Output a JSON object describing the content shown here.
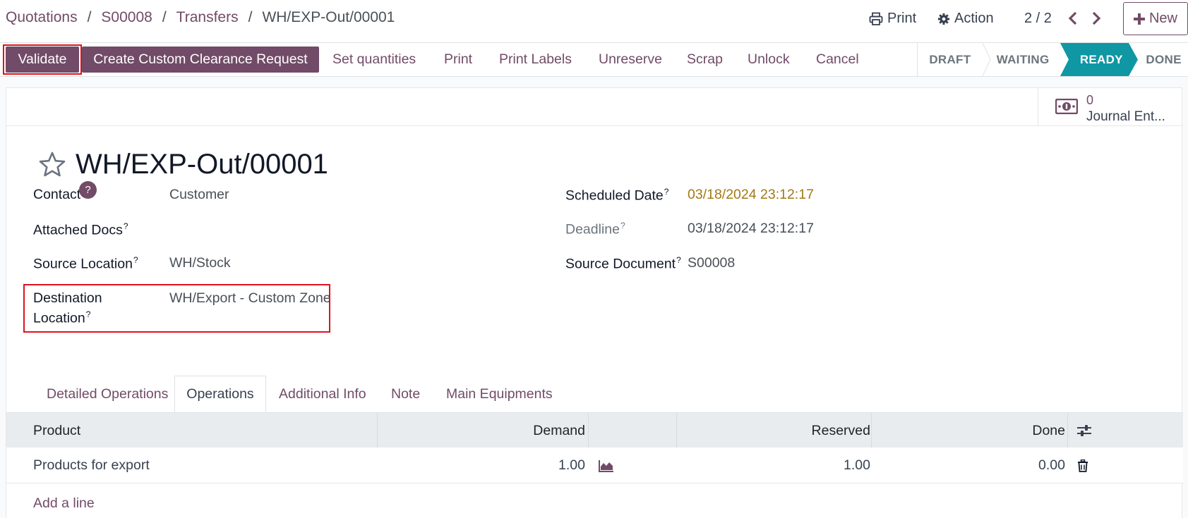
{
  "breadcrumb": {
    "items": [
      "Quotations",
      "S00008",
      "Transfers"
    ],
    "separator": "/",
    "current": "WH/EXP-Out/00001"
  },
  "top_actions": {
    "print_label": "Print",
    "action_label": "Action",
    "pager": "2 / 2",
    "new_label": "New"
  },
  "action_bar": {
    "validate": "Validate",
    "custom_clearance": "Create Custom Clearance Request",
    "set_quantities": "Set quantities",
    "print": "Print",
    "print_labels": "Print Labels",
    "unreserve": "Unreserve",
    "scrap": "Scrap",
    "unlock": "Unlock",
    "cancel": "Cancel"
  },
  "status": {
    "stages": [
      "DRAFT",
      "WAITING",
      "READY",
      "DONE"
    ],
    "active": "READY"
  },
  "smart_button": {
    "value": "0",
    "label": "Journal Ent..."
  },
  "record": {
    "title": "WH/EXP-Out/00001"
  },
  "fields": {
    "contact": {
      "label": "Contact",
      "badge": "?",
      "value": "Customer"
    },
    "attached_docs": {
      "label": "Attached Docs",
      "sup": "?",
      "value": ""
    },
    "source_location": {
      "label": "Source Location",
      "sup": "?",
      "value": "WH/Stock"
    },
    "destination_location": {
      "label_line1": "Destination",
      "label_line2": "Location",
      "sup": "?",
      "value": "WH/Export - Custom Zone"
    },
    "scheduled_date": {
      "label": "Scheduled Date",
      "sup": "?",
      "value": "03/18/2024 23:12:17"
    },
    "deadline": {
      "label": "Deadline",
      "sup": "?",
      "value": "03/18/2024 23:12:17"
    },
    "source_document": {
      "label": "Source Document",
      "sup": "?",
      "value": "S00008"
    }
  },
  "tabs": [
    "Detailed Operations",
    "Operations",
    "Additional Info",
    "Note",
    "Main Equipments"
  ],
  "active_tab": "Operations",
  "table": {
    "columns": [
      "Product",
      "Demand",
      "Reserved",
      "Done"
    ],
    "rows": [
      {
        "product": "Products for export",
        "demand": "1.00",
        "reserved": "1.00",
        "done": "0.00"
      }
    ],
    "add_line": "Add a line"
  },
  "colors": {
    "brand": "#714B67",
    "status_active": "#0f97a3",
    "highlight": "#e0121d",
    "date_warning": "#a07a14"
  },
  "icons": [
    "print-icon",
    "gear-icon",
    "chevron-left-icon",
    "chevron-right-icon",
    "plus-icon",
    "money-icon",
    "star-icon",
    "forecast-chart-icon",
    "trash-icon",
    "column-settings-icon"
  ]
}
